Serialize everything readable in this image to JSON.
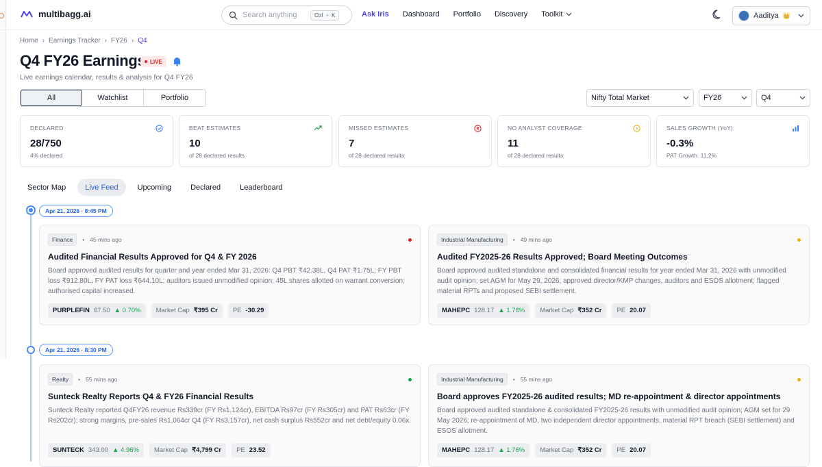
{
  "brand": {
    "name": "multibagg.ai"
  },
  "search": {
    "placeholder": "Search anything",
    "shortcut_ctrl": "Ctrl",
    "shortcut_plus": "+",
    "shortcut_key": "K"
  },
  "nav": {
    "ask": "Ask Iris",
    "dashboard": "Dashboard",
    "portfolio": "Portfolio",
    "discovery": "Discovery",
    "toolkit": "Toolkit"
  },
  "user": {
    "name": "Aaditya",
    "badge": "👑"
  },
  "breadcrumb": {
    "home": "Home",
    "tracker": "Earnings Tracker",
    "year": "FY26",
    "current": "Q4"
  },
  "page": {
    "title": "Q4 FY26 Earnings",
    "live": "LIVE",
    "subtitle": "Live earnings calendar, results & analysis for Q4 FY26"
  },
  "segment": {
    "all": "All",
    "watchlist": "Watchlist",
    "portfolio": "Portfolio"
  },
  "filters": {
    "market": "Nifty Total Market",
    "year": "FY26",
    "quarter": "Q4"
  },
  "stats": [
    {
      "label": "DECLARED",
      "value": "28/750",
      "sub": "4% declared",
      "color": "#3b82f6"
    },
    {
      "label": "BEAT ESTIMATES",
      "value": "10",
      "sub": "of 28 declared results",
      "color": "#16a34a"
    },
    {
      "label": "MISSED ESTIMATES",
      "value": "7",
      "sub": "of 28 declared results",
      "color": "#dc2626"
    },
    {
      "label": "NO ANALYST COVERAGE",
      "value": "11",
      "sub": "of 28 declared results",
      "color": "#eab308"
    },
    {
      "label": "SALES GROWTH (YoY)",
      "value": "-0.3%",
      "sub": "PAT Growth: 11.2%",
      "color": "#3b82f6"
    }
  ],
  "tabs": {
    "sector": "Sector Map",
    "live": "Live Feed",
    "upcoming": "Upcoming",
    "declared": "Declared",
    "leaderboard": "Leaderboard"
  },
  "feed": {
    "time1": "Apr 21, 2026 · 8:45 PM",
    "time2": "Apr 21, 2026 · 8:30 PM",
    "cards": [
      {
        "tag": "Finance",
        "ago": "45 mins ago",
        "dot": "#dc2626",
        "title": "Audited Financial Results Approved for Q4 & FY 2026",
        "body": "Board approved audited results for quarter and year ended Mar 31, 2026: Q4 PBT ₹42.38L, Q4 PAT ₹1.75L; FY PBT loss ₹912.80L, FY PAT loss ₹644.10L; auditors issued unmodified opinion; 45L shares allotted on warrant conversion; authorised capital increased.",
        "ticker": "PURPLEFIN",
        "price": "67.50",
        "change": "▲ 0.70%",
        "mcap_label": "Market Cap",
        "mcap": "₹395 Cr",
        "pe_label": "PE",
        "pe": "-30.29"
      },
      {
        "tag": "Industrial Manufacturing",
        "ago": "49 mins ago",
        "dot": "#eab308",
        "title": "Audited FY2025-26 Results Approved; Board Meeting Outcomes",
        "body": "Board approved audited standalone and consolidated financial results for year ended Mar 31, 2026 with unmodified audit opinion; set AGM for May 29, 2026; approved director/KMP changes, auditors and ESOS allotment; flagged material RPTs and proposed SEBI settlement.",
        "ticker": "MAHEPC",
        "price": "128.17",
        "change": "▲ 1.76%",
        "mcap_label": "Market Cap",
        "mcap": "₹352 Cr",
        "pe_label": "PE",
        "pe": "20.07"
      },
      {
        "tag": "Realty",
        "ago": "55 mins ago",
        "dot": "#16a34a",
        "title": "Sunteck Realty Reports Q4 & FY26 Financial Results",
        "body": "Sunteck Realty reported Q4FY26 revenue Rs339cr (FY Rs1,124cr), EBITDA Rs97cr (FY Rs305cr) and PAT Rs63cr (FY Rs202cr); strong margins, pre-sales Rs1,064cr Q4 (FY Rs3,157cr), net cash surplus Rs552cr and net debt/equity 0.06x.",
        "ticker": "SUNTECK",
        "price": "343.00",
        "change": "▲ 4.96%",
        "mcap_label": "Market Cap",
        "mcap": "₹4,799 Cr",
        "pe_label": "PE",
        "pe": "23.52"
      },
      {
        "tag": "Industrial Manufacturing",
        "ago": "55 mins ago",
        "dot": "#eab308",
        "title": "Board approves FY2025-26 audited results; MD re-appointment & director appointments",
        "body": "Board approved audited standalone & consolidated FY2025-26 results with unmodified audit opinion; AGM set for 29 May 2026; re-appointment of MD, two independent director appointments, material RPT breach (SEBI settlement) and ESOS allotment.",
        "ticker": "MAHEPC",
        "price": "128.17",
        "change": "▲ 1.76%",
        "mcap_label": "Market Cap",
        "mcap": "₹352 Cr",
        "pe_label": "PE",
        "pe": "20.07"
      }
    ]
  }
}
